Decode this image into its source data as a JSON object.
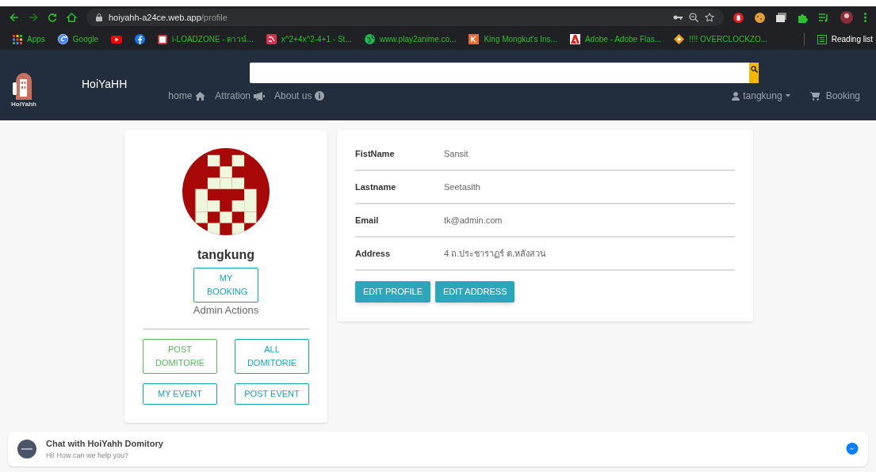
{
  "browser": {
    "address_host": "hoiyahh-a24ce.web.app",
    "address_path": "/profile",
    "bookmarks": [
      {
        "kind": "link",
        "label": "Apps"
      },
      {
        "kind": "link",
        "label": "Google"
      },
      {
        "kind": "icon"
      },
      {
        "kind": "icon"
      },
      {
        "label": "i-LOADZONE - ตาวน์..."
      },
      {
        "label": "x^2+4x^2-4+1 - St..."
      },
      {
        "label": "www.play2anime.co..."
      },
      {
        "label": "King Mongkut's Ins..."
      },
      {
        "label": "Adobe - Adobe Flas..."
      },
      {
        "label": "!!!! OVERCLOCKZO..."
      }
    ],
    "reading_list": "Reading list"
  },
  "navbar": {
    "brand": "HoiYaHH",
    "logo_caption": "HoiYahh",
    "links": [
      "home",
      "Attration",
      "About us"
    ],
    "user": "tangkung",
    "booking": "Booking"
  },
  "profile": {
    "username": "tangkung",
    "my_booking": "MY BOOKING",
    "admin_title": "Admin Actions",
    "admin_buttons": [
      {
        "label": "POST DOMITORIE",
        "color": "#5cb85c"
      },
      {
        "label": "ALL DOMITORIE",
        "color": "#17a2b8"
      },
      {
        "label": "MY EVENT",
        "color": "#17a2b8"
      },
      {
        "label": "POST EVENT",
        "color": "#17a2b8"
      }
    ]
  },
  "details": [
    {
      "label": "FistName",
      "value": "Sansit"
    },
    {
      "label": "Lastname",
      "value": "Seetasith"
    },
    {
      "label": "Email",
      "value": "tk@admin.com"
    },
    {
      "label": "Address",
      "value": "4 ถ.ประชาราฏร์ ต.หลังสวน"
    }
  ],
  "detail_buttons": [
    "EDIT PROFILE",
    "EDIT ADDRESS"
  ],
  "chat": {
    "title": "Chat with HoiYahh Domitory",
    "subtitle": "Hi! How can we help you?"
  }
}
